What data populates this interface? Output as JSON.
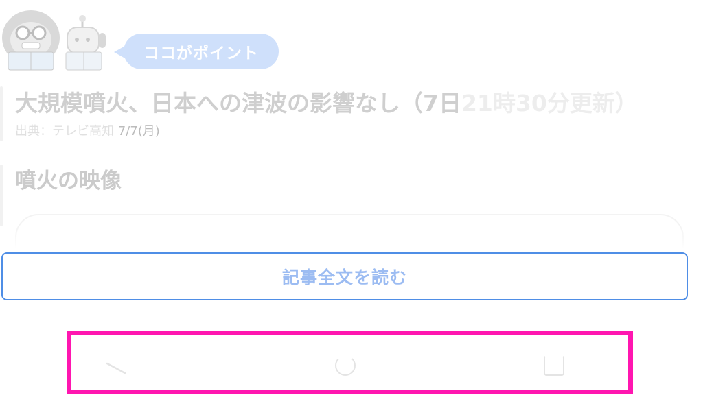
{
  "point_badge": {
    "label": "ココがポイント"
  },
  "article": {
    "headline_main": "大規模噴火、日本への津波の影響なし（7日",
    "headline_tail": "21時30分更新）",
    "source_prefix": "出典：テレビ高知",
    "source_date": "7/7(月)"
  },
  "video_section": {
    "title": "噴火の映像"
  },
  "read_more": {
    "label": "記事全文を読む"
  },
  "colors": {
    "accent": "#4f8ee6",
    "highlight": "#ff16b0",
    "badge": "#cfe0fb"
  },
  "icons": [
    "mascot-gorilla-icon",
    "mascot-robot-icon",
    "nav-back-icon",
    "nav-home-icon",
    "nav-recent-icon"
  ]
}
